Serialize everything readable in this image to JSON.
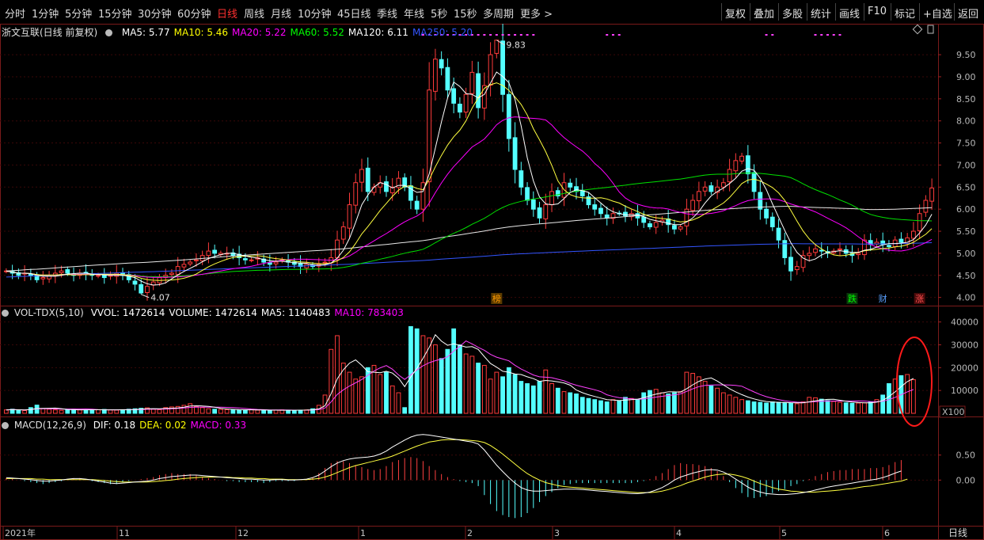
{
  "toolbar": {
    "left_items": [
      "分时",
      "1分钟",
      "5分钟",
      "15分钟",
      "30分钟",
      "60分钟",
      "日线",
      "周线",
      "月线",
      "10分钟",
      "45日线",
      "季线",
      "年线",
      "5秒",
      "15秒",
      "多周期",
      "更多 >"
    ],
    "active_item": "日线",
    "right_items": [
      "复权",
      "叠加",
      "多股",
      "统计",
      "画线",
      "F10",
      "标记",
      "+自选",
      "返回"
    ]
  },
  "main_panel": {
    "title": "浙文互联(日线 前复权)",
    "ma_legend": [
      {
        "label": "MA5: 5.77",
        "color": "#ffffff"
      },
      {
        "label": "MA10: 5.46",
        "color": "#ffff00"
      },
      {
        "label": "MA20: 5.22",
        "color": "#ff00ff"
      },
      {
        "label": "MA60: 5.52",
        "color": "#00ff00"
      },
      {
        "label": "MA120: 6.11",
        "color": "#ffffff"
      },
      {
        "label": "MA250: 5.20",
        "color": "#3355ff"
      }
    ],
    "high_label": "9.83",
    "low_label": "4.07",
    "markers": [
      {
        "text": "榜",
        "color": "#ff9900",
        "bg": "#5a3a00"
      },
      {
        "text": "跌",
        "color": "#00ff00",
        "bg": "#0a3a0a"
      },
      {
        "text": "财",
        "color": "#5aa0ff",
        "bg": "#000000"
      },
      {
        "text": "涨",
        "color": "#ff5050",
        "bg": "#4a0a0a"
      }
    ]
  },
  "volume_panel": {
    "title": "VOL-TDX(5,10)",
    "legend": [
      {
        "label": "VVOL: 1472614",
        "color": "#ffffff"
      },
      {
        "label": "VOLUME: 1472614",
        "color": "#ffffff"
      },
      {
        "label": "MA5: 1140483",
        "color": "#ffffff"
      },
      {
        "label": "MA10: 783403",
        "color": "#ff00ff"
      }
    ],
    "unit": "X100"
  },
  "macd_panel": {
    "title": "MACD(12,26,9)",
    "legend": [
      {
        "label": "DIF: 0.18",
        "color": "#ffffff"
      },
      {
        "label": "DEA: 0.02",
        "color": "#ffff00"
      },
      {
        "label": "MACD: 0.33",
        "color": "#ff00ff"
      }
    ]
  },
  "x_axis": {
    "labels": [
      "2021年",
      "11",
      "12",
      "1",
      "2",
      "3",
      "4",
      "5",
      "6"
    ],
    "period_label": "日线"
  },
  "chart_data": [
    {
      "type": "candlestick",
      "title": "浙文互联(日线 前复权)",
      "y_ticks": [
        4.0,
        4.5,
        5.0,
        5.5,
        6.0,
        6.5,
        7.0,
        7.5,
        8.0,
        8.5,
        9.0,
        9.5
      ],
      "ylim": [
        3.85,
        9.95
      ],
      "key_prices": {
        "high": 9.83,
        "low": 4.07,
        "last_close": 6.48
      },
      "series": [
        {
          "name": "MA5",
          "last": 5.77
        },
        {
          "name": "MA10",
          "last": 5.46
        },
        {
          "name": "MA20",
          "last": 5.22
        },
        {
          "name": "MA60",
          "last": 5.52
        },
        {
          "name": "MA120",
          "last": 6.11
        },
        {
          "name": "MA250",
          "last": 5.2
        }
      ],
      "close": [
        4.6,
        4.55,
        4.5,
        4.55,
        4.5,
        4.4,
        4.45,
        4.5,
        4.55,
        4.6,
        4.55,
        4.5,
        4.55,
        4.55,
        4.5,
        4.5,
        4.45,
        4.5,
        4.55,
        4.5,
        4.4,
        4.3,
        4.1,
        4.25,
        4.35,
        4.45,
        4.5,
        4.55,
        4.7,
        4.75,
        4.8,
        4.85,
        4.95,
        5.05,
        5.0,
        5.0,
        5.0,
        4.95,
        4.9,
        4.85,
        4.85,
        4.9,
        4.8,
        4.75,
        4.8,
        4.85,
        4.8,
        4.75,
        4.7,
        4.75,
        4.7,
        4.75,
        4.8,
        4.9,
        5.3,
        5.6,
        6.1,
        6.6,
        6.9,
        6.4,
        6.5,
        6.6,
        6.4,
        6.5,
        6.7,
        6.5,
        6.2,
        6.0,
        6.6,
        8.7,
        9.4,
        9.2,
        8.7,
        8.4,
        8.2,
        8.6,
        9.1,
        8.3,
        8.8,
        9.5,
        9.83,
        8.6,
        7.6,
        6.9,
        6.5,
        6.2,
        6.0,
        5.8,
        6.1,
        6.4,
        6.3,
        6.6,
        6.5,
        6.4,
        6.3,
        6.1,
        6.0,
        5.9,
        5.8,
        5.9,
        5.9,
        5.85,
        5.9,
        5.8,
        5.7,
        5.6,
        5.7,
        5.75,
        5.65,
        5.55,
        5.6,
        6.0,
        6.2,
        6.4,
        6.5,
        6.4,
        6.5,
        6.6,
        6.9,
        7.1,
        7.2,
        6.8,
        6.4,
        6.0,
        5.8,
        5.6,
        5.3,
        4.9,
        4.6,
        4.7,
        4.95,
        5.0,
        5.1,
        5.05,
        5.0,
        5.05,
        5.1,
        5.0,
        4.95,
        5.0,
        5.3,
        5.2,
        5.25,
        5.2,
        5.15,
        5.3,
        5.25,
        5.35,
        5.5,
        5.9,
        6.2,
        6.48
      ],
      "volume_ticks": [
        10000,
        20000,
        30000,
        40000
      ],
      "volume_ylim": [
        0,
        43000
      ],
      "volume": [
        1500,
        1800,
        1400,
        1200,
        2500,
        3600,
        2000,
        1800,
        1500,
        1300,
        1600,
        1800,
        1500,
        1400,
        1500,
        1600,
        1700,
        1500,
        1400,
        1600,
        1800,
        2000,
        2200,
        2400,
        1800,
        1600,
        2500,
        2800,
        3000,
        3500,
        4200,
        3000,
        2500,
        2000,
        1800,
        1700,
        1600,
        1500,
        1400,
        1500,
        1600,
        1400,
        1300,
        1200,
        1400,
        1500,
        1400,
        1300,
        1400,
        1500,
        2000,
        3500,
        8000,
        28000,
        34000,
        22000,
        18000,
        15000,
        16000,
        20000,
        21000,
        17000,
        18000,
        12000,
        9000,
        2500,
        38000,
        37000,
        34000,
        33000,
        30000,
        24000,
        28000,
        37000,
        30000,
        26000,
        25000,
        22000,
        21000,
        15000,
        18000,
        16000,
        20000,
        17000,
        14000,
        13000,
        12000,
        14000,
        19000,
        13000,
        11000,
        9500,
        9000,
        8500,
        7000,
        6500,
        6000,
        5500,
        5000,
        6000,
        5500,
        7000,
        6500,
        6000,
        9000,
        10000,
        10500,
        9000,
        8500,
        9000,
        9500,
        18000,
        17500,
        16000,
        14000,
        12000,
        11000,
        9000,
        8000,
        7000,
        6000,
        5500,
        5000,
        4800,
        4500,
        5000,
        4800,
        4600,
        4400,
        4200,
        5000,
        7000,
        6800,
        6200,
        5600,
        5200,
        4800,
        4600,
        4400,
        4500,
        4600,
        5000,
        6000,
        8000,
        13000,
        15000,
        16500,
        17000,
        14726
      ],
      "volume_ma": [
        {
          "name": "MA5",
          "last": 11404.83
        },
        {
          "name": "MA10",
          "last": 7834.03
        }
      ],
      "macd_ticks": [
        0.0,
        0.5
      ],
      "macd_ylim": [
        -0.85,
        1.05
      ],
      "dif": [
        0.05,
        0.04,
        0.03,
        0.02,
        0.01,
        -0.01,
        -0.02,
        -0.02,
        -0.01,
        0.0,
        0.02,
        0.03,
        0.03,
        0.02,
        0.0,
        -0.02,
        -0.04,
        -0.06,
        -0.07,
        -0.06,
        -0.05,
        -0.04,
        -0.03,
        -0.02,
        0.0,
        0.03,
        0.05,
        0.07,
        0.08,
        0.09,
        0.1,
        0.1,
        0.09,
        0.08,
        0.07,
        0.06,
        0.05,
        0.04,
        0.03,
        0.02,
        0.02,
        0.01,
        0.0,
        0.0,
        0.01,
        0.01,
        0.0,
        0.0,
        0.01,
        0.02,
        0.05,
        0.1,
        0.18,
        0.27,
        0.34,
        0.39,
        0.42,
        0.44,
        0.45,
        0.46,
        0.48,
        0.52,
        0.58,
        0.66,
        0.73,
        0.8,
        0.86,
        0.9,
        0.91,
        0.9,
        0.88,
        0.86,
        0.84,
        0.82,
        0.8,
        0.78,
        0.76,
        0.72,
        0.6,
        0.45,
        0.3,
        0.17,
        0.05,
        -0.06,
        -0.15,
        -0.2,
        -0.22,
        -0.22,
        -0.21,
        -0.2,
        -0.19,
        -0.18,
        -0.18,
        -0.18,
        -0.19,
        -0.2,
        -0.21,
        -0.22,
        -0.23,
        -0.24,
        -0.25,
        -0.26,
        -0.27,
        -0.27,
        -0.26,
        -0.24,
        -0.2,
        -0.15,
        -0.08,
        0.0,
        0.06,
        0.1,
        0.14,
        0.17,
        0.2,
        0.21,
        0.2,
        0.16,
        0.1,
        0.02,
        -0.06,
        -0.14,
        -0.2,
        -0.24,
        -0.27,
        -0.28,
        -0.29,
        -0.29,
        -0.28,
        -0.27,
        -0.25,
        -0.23,
        -0.2,
        -0.17,
        -0.14,
        -0.12,
        -0.1,
        -0.08,
        -0.06,
        -0.04,
        -0.02,
        0.0,
        0.02,
        0.05,
        0.09,
        0.14,
        0.18
      ],
      "dea": [
        0.03,
        0.03,
        0.03,
        0.03,
        0.03,
        0.02,
        0.02,
        0.01,
        0.01,
        0.01,
        0.01,
        0.01,
        0.01,
        0.01,
        0.01,
        0.0,
        -0.01,
        -0.02,
        -0.03,
        -0.04,
        -0.04,
        -0.04,
        -0.04,
        -0.04,
        -0.03,
        -0.02,
        -0.01,
        0.0,
        0.02,
        0.03,
        0.04,
        0.05,
        0.06,
        0.06,
        0.06,
        0.06,
        0.06,
        0.05,
        0.05,
        0.04,
        0.04,
        0.03,
        0.03,
        0.02,
        0.02,
        0.02,
        0.01,
        0.01,
        0.01,
        0.01,
        0.02,
        0.03,
        0.06,
        0.1,
        0.15,
        0.2,
        0.25,
        0.29,
        0.32,
        0.35,
        0.38,
        0.41,
        0.44,
        0.48,
        0.53,
        0.58,
        0.63,
        0.68,
        0.72,
        0.76,
        0.78,
        0.8,
        0.81,
        0.81,
        0.81,
        0.8,
        0.79,
        0.78,
        0.75,
        0.69,
        0.61,
        0.52,
        0.42,
        0.32,
        0.22,
        0.13,
        0.06,
        0.0,
        -0.05,
        -0.08,
        -0.11,
        -0.13,
        -0.14,
        -0.15,
        -0.16,
        -0.17,
        -0.18,
        -0.19,
        -0.2,
        -0.21,
        -0.22,
        -0.23,
        -0.24,
        -0.25,
        -0.25,
        -0.25,
        -0.24,
        -0.22,
        -0.19,
        -0.15,
        -0.11,
        -0.06,
        -0.02,
        0.02,
        0.06,
        0.09,
        0.11,
        0.12,
        0.12,
        0.1,
        0.07,
        0.03,
        -0.02,
        -0.07,
        -0.11,
        -0.15,
        -0.18,
        -0.2,
        -0.22,
        -0.23,
        -0.24,
        -0.24,
        -0.24,
        -0.23,
        -0.22,
        -0.21,
        -0.2,
        -0.18,
        -0.17,
        -0.15,
        -0.13,
        -0.12,
        -0.1,
        -0.08,
        -0.06,
        -0.04,
        -0.02,
        0.02
      ]
    }
  ]
}
